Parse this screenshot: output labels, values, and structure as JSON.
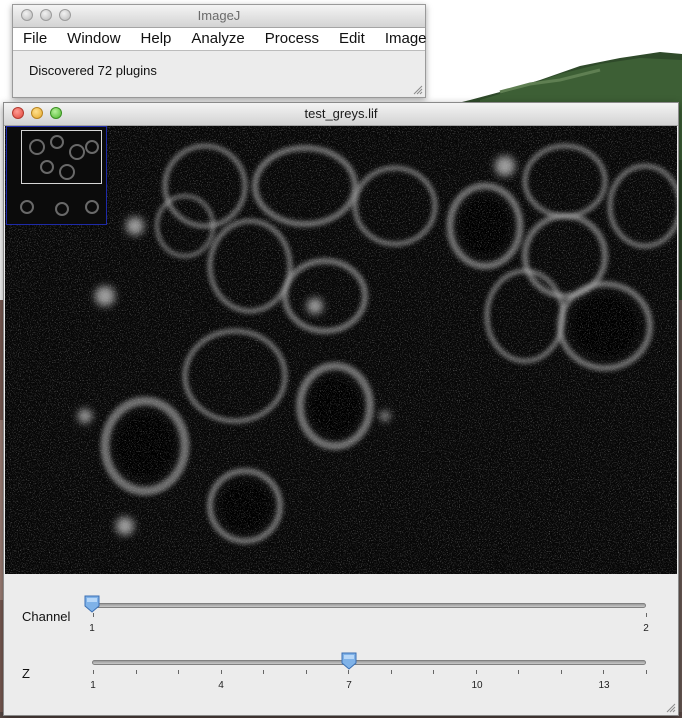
{
  "imagej_window": {
    "title": "ImageJ",
    "menus": [
      "File",
      "Window",
      "Help",
      "Analyze",
      "Process",
      "Edit",
      "Image"
    ],
    "status": "Discovered 72 plugins"
  },
  "image_window": {
    "title": "test_greys.lif",
    "sliders": {
      "channel": {
        "label": "Channel",
        "min": 1,
        "max": 2,
        "value": 1,
        "tick_labels": [
          "1",
          "2"
        ]
      },
      "z": {
        "label": "Z",
        "min": 1,
        "max": 14,
        "value": 7,
        "tick_labels": [
          "1",
          "4",
          "7",
          "10",
          "13"
        ]
      }
    }
  },
  "colors": {
    "navigator_border": "#1e2aa8",
    "image_background": "#070707"
  }
}
